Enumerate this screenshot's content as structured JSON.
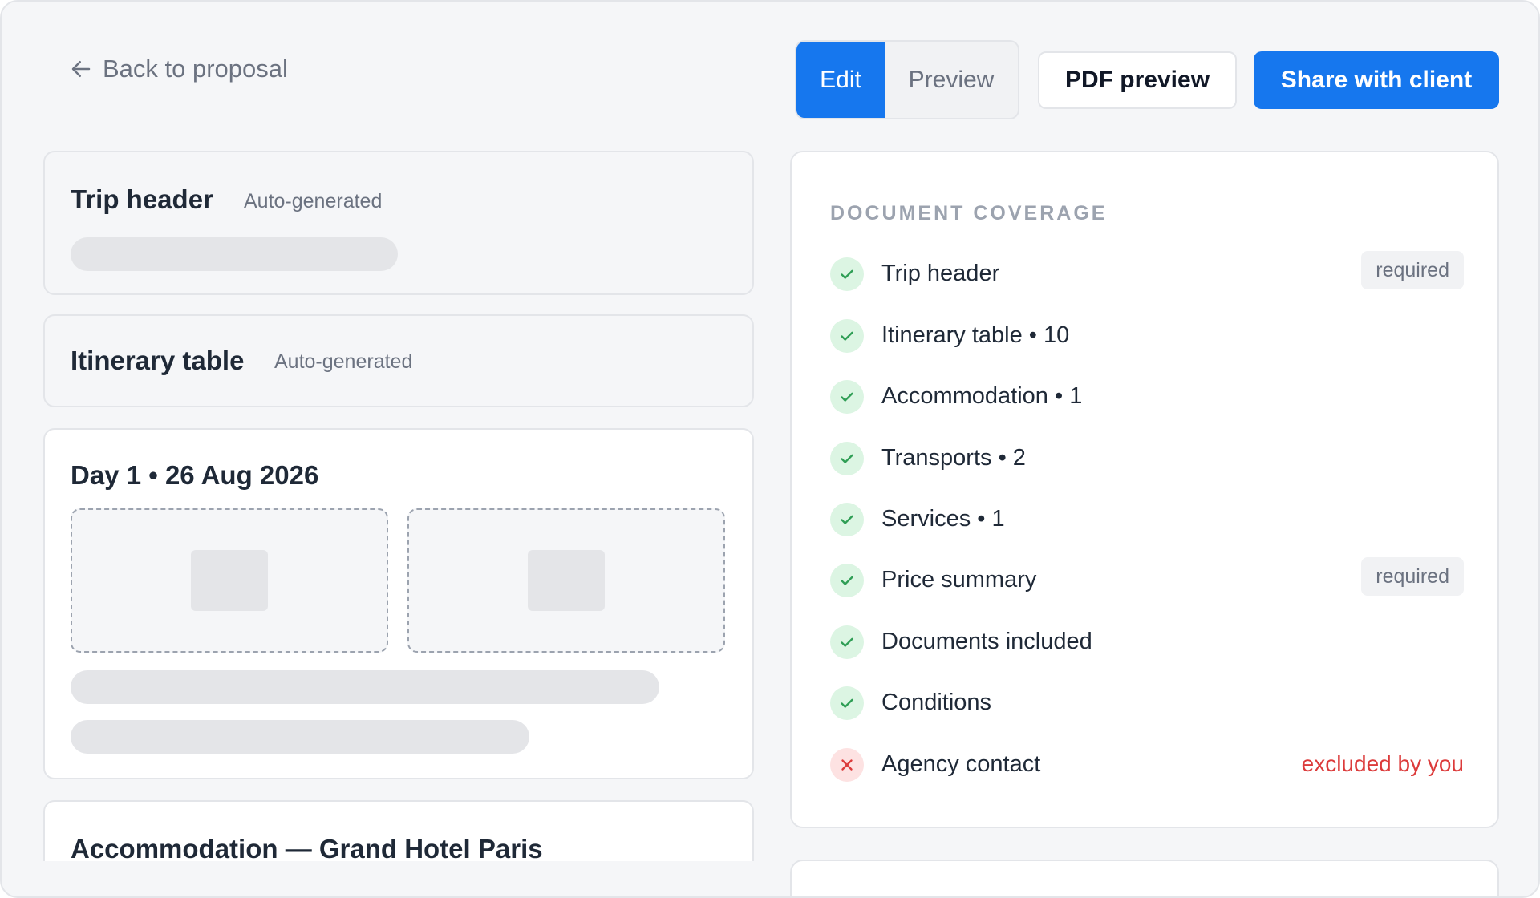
{
  "header": {
    "back_label": "Back to proposal",
    "mode_tabs": [
      {
        "label": "Edit",
        "active": true
      },
      {
        "label": "Preview",
        "active": false
      }
    ],
    "pdf_preview_label": "PDF preview",
    "share_label": "Share with client"
  },
  "sections": {
    "trip_header": {
      "title": "Trip header",
      "tag": "Auto-generated"
    },
    "itinerary_table": {
      "title": "Itinerary table",
      "tag": "Auto-generated"
    },
    "day1": {
      "title": "Day 1 • 26 Aug 2026"
    },
    "accommodation": {
      "title": "Accommodation — Grand Hotel Paris"
    }
  },
  "coverage": {
    "heading": "DOCUMENT COVERAGE",
    "items": [
      {
        "label": "Trip header",
        "status": "included",
        "badge": "required",
        "icon": "check-icon"
      },
      {
        "label": "Itinerary table • 10",
        "status": "included",
        "icon": "check-icon"
      },
      {
        "label": "Accommodation • 1",
        "status": "included",
        "icon": "check-icon"
      },
      {
        "label": "Transports • 2",
        "status": "included",
        "icon": "check-icon"
      },
      {
        "label": "Services • 1",
        "status": "included",
        "icon": "check-icon"
      },
      {
        "label": "Price summary",
        "status": "included",
        "badge": "required",
        "icon": "check-icon"
      },
      {
        "label": "Documents included",
        "status": "included",
        "icon": "check-icon"
      },
      {
        "label": "Conditions",
        "status": "included",
        "icon": "check-icon"
      },
      {
        "label": "Agency contact",
        "status": "excluded",
        "note": "excluded by you",
        "icon": "x-icon"
      }
    ]
  },
  "colors": {
    "accent": "#1677ee",
    "success": "#2f9e55",
    "success_bg": "#dcf5e3",
    "danger": "#dc3b3b",
    "danger_bg": "#fde2e2"
  }
}
